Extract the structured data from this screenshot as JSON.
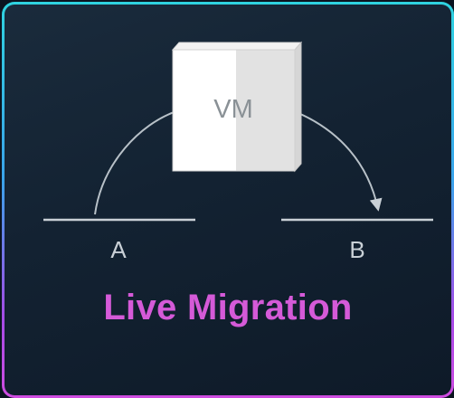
{
  "diagram": {
    "vm_label": "VM",
    "host_a_label": "A",
    "host_b_label": "B",
    "title": "Live Migration"
  },
  "colors": {
    "title": "#d55ad8",
    "lines": "#c9d0d6",
    "vm_front": "#ffffff",
    "vm_shade": "#e3e3e3",
    "vm_text": "#8a9196"
  }
}
